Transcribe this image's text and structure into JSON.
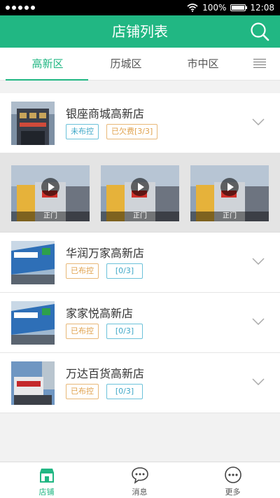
{
  "status_bar": {
    "battery": "100%",
    "time": "12:08"
  },
  "header": {
    "title": "店铺列表"
  },
  "tabs": [
    {
      "label": "高新区",
      "active": true
    },
    {
      "label": "历城区",
      "active": false
    },
    {
      "label": "市中区",
      "active": false
    }
  ],
  "stores": [
    {
      "name": "银座商城高新店",
      "badges": [
        "未布控",
        "已欠费[3/3]"
      ]
    },
    {
      "name": "华润万家高新店",
      "badges": [
        "已布控",
        "[0/3]"
      ]
    },
    {
      "name": "家家悦高新店",
      "badges": [
        "已布控",
        "[0/3]"
      ]
    },
    {
      "name": "万达百货高新店",
      "badges": [
        "已布控",
        "[0/3]"
      ]
    }
  ],
  "videos": [
    {
      "label": "正门"
    },
    {
      "label": "正门"
    },
    {
      "label": "正门"
    }
  ],
  "bottom_nav": [
    {
      "label": "店铺",
      "active": true
    },
    {
      "label": "消息",
      "active": false
    },
    {
      "label": "更多",
      "active": false
    }
  ],
  "colors": {
    "accent": "#21b783",
    "badge_blue": "#3ea7c7",
    "badge_orange": "#e0a14c"
  }
}
